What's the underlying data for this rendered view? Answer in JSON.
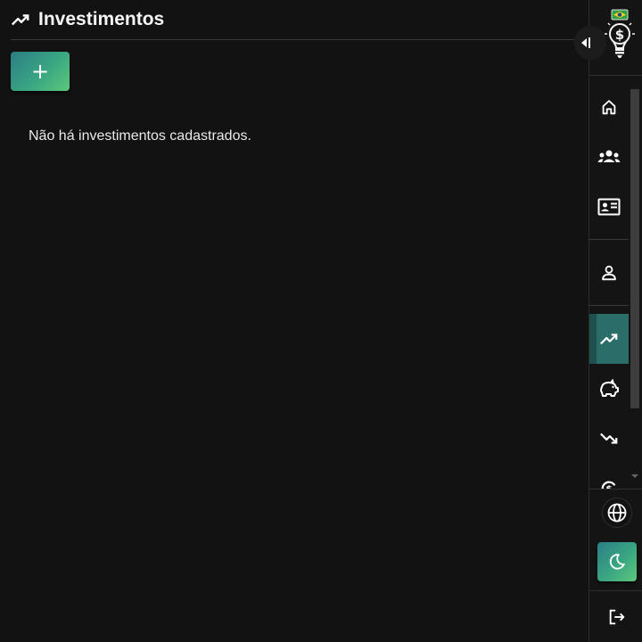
{
  "page": {
    "title": "Investimentos",
    "title_icon": "trending-up-icon",
    "add_label": "+",
    "empty_message": "Não há investimentos cadastrados."
  },
  "sidebar": {
    "logo": "money-bulb-logo",
    "collapse_icon": "collapse-left-icon",
    "nav_items": [
      {
        "icon": "home-icon",
        "active": false
      },
      {
        "icon": "group-icon",
        "active": false
      },
      {
        "icon": "id-card-icon",
        "active": false
      },
      {
        "icon": "person-icon",
        "active": false
      },
      {
        "icon": "trending-up-icon",
        "active": true
      },
      {
        "icon": "piggy-bank-icon",
        "active": false
      },
      {
        "icon": "trending-down-icon",
        "active": false
      },
      {
        "icon": "currency-exchange-icon",
        "active": false
      }
    ],
    "language_icon": "globe-icon",
    "theme_icon": "moon-icon",
    "logout_icon": "logout-icon"
  },
  "colors": {
    "background": "#121212",
    "accent_gradient_start": "#2b7e85",
    "accent_gradient_end": "#5cc87c",
    "active_nav": "#2a6d69"
  }
}
